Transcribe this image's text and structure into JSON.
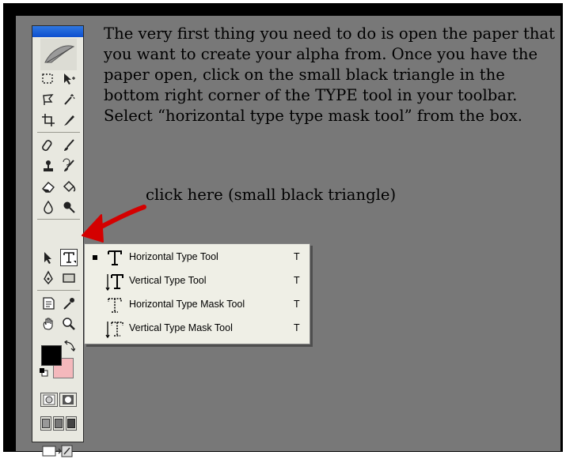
{
  "instructions": {
    "paragraph": "The very first thing you need to do is open the paper that you want to create your alpha from. Once you have the paper open, click on the small black triangle in the bottom right corner of the TYPE tool in your toolbar. Select “horizontal type type mask tool” from the box.",
    "annotation": "click here (small black triangle)"
  },
  "toolbar": {
    "tools": [
      "marquee-icon",
      "move-icon",
      "lasso-icon",
      "magic-wand-icon",
      "crop-icon",
      "slice-icon",
      "healing-brush-icon",
      "brush-icon",
      "clone-stamp-icon",
      "history-brush-icon",
      "eraser-icon",
      "paint-bucket-icon",
      "blur-icon",
      "dodge-icon",
      "path-selection-icon",
      "type-icon",
      "pen-icon",
      "rectangle-shape-icon",
      "notes-icon",
      "eyedropper-icon",
      "hand-icon",
      "zoom-icon"
    ],
    "active_tool": "type-icon",
    "foreground_color": "#000000",
    "background_color": "#f4b8bc"
  },
  "flyout_menu": {
    "items": [
      {
        "label": "Horizontal Type Tool",
        "shortcut": "T",
        "selected": true,
        "icon": "horizontal-type-icon"
      },
      {
        "label": "Vertical Type Tool",
        "shortcut": "T",
        "selected": false,
        "icon": "vertical-type-icon"
      },
      {
        "label": "Horizontal Type Mask Tool",
        "shortcut": "T",
        "selected": false,
        "icon": "horizontal-type-mask-icon"
      },
      {
        "label": "Vertical Type Mask Tool",
        "shortcut": "T",
        "selected": false,
        "icon": "vertical-type-mask-icon"
      }
    ]
  },
  "colors": {
    "canvas": "#787878",
    "arrow": "#d40000",
    "menu_bg": "#efefe6"
  }
}
